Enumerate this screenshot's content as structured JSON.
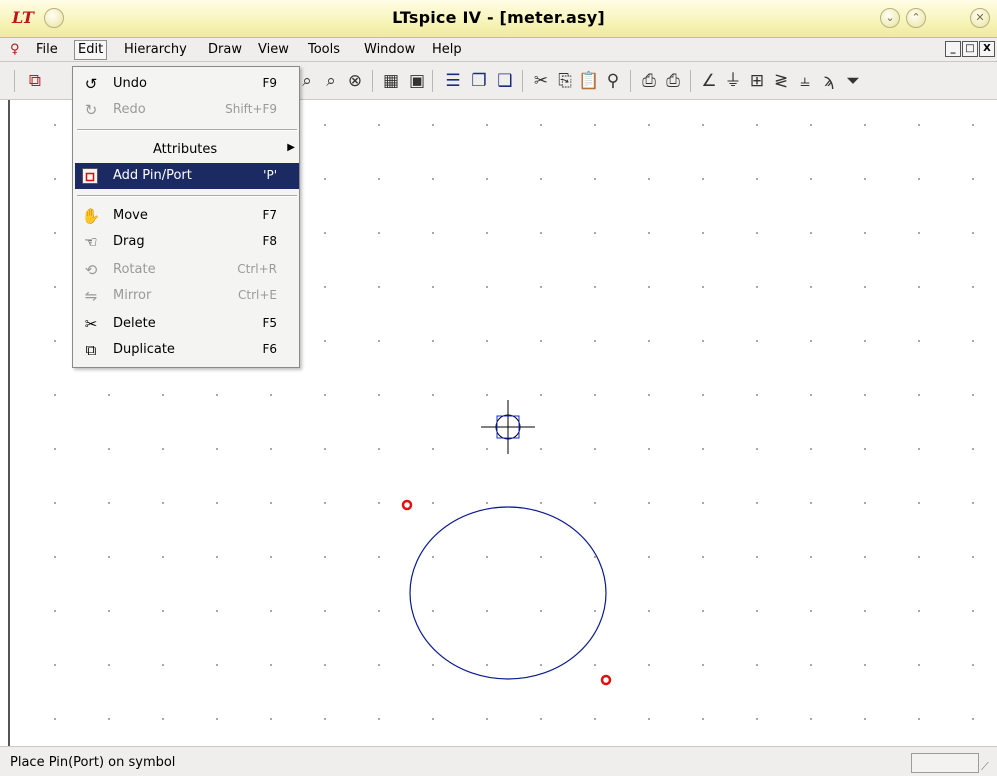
{
  "window": {
    "title": "LTspice IV - [meter.asy]",
    "logo": "LT"
  },
  "menubar": {
    "items": [
      "File",
      "Edit",
      "Hierarchy",
      "Draw",
      "View",
      "Tools",
      "Window",
      "Help"
    ],
    "active": "Edit",
    "mdi": [
      "_",
      "□",
      "X"
    ]
  },
  "edit_menu": {
    "items": [
      {
        "label": "Undo",
        "shortcut": "F9",
        "icon": "undo-icon",
        "enabled": true
      },
      {
        "label": "Redo",
        "shortcut": "Shift+F9",
        "icon": "redo-icon",
        "enabled": false
      },
      {
        "label": "Attributes",
        "shortcut": "",
        "icon": "",
        "enabled": true,
        "submenu": true
      },
      {
        "label": "Add Pin/Port",
        "shortcut": "'P'",
        "icon": "pin-port-icon",
        "enabled": true,
        "highlighted": true
      },
      {
        "label": "Move",
        "shortcut": "F7",
        "icon": "move-hand-icon",
        "enabled": true
      },
      {
        "label": "Drag",
        "shortcut": "F8",
        "icon": "drag-hand-icon",
        "enabled": true
      },
      {
        "label": "Rotate",
        "shortcut": "Ctrl+R",
        "icon": "rotate-icon",
        "enabled": false
      },
      {
        "label": "Mirror",
        "shortcut": "Ctrl+E",
        "icon": "mirror-icon",
        "enabled": false
      },
      {
        "label": "Delete",
        "shortcut": "F5",
        "icon": "scissors-icon",
        "enabled": true
      },
      {
        "label": "Duplicate",
        "shortcut": "F6",
        "icon": "duplicate-icon",
        "enabled": true
      }
    ]
  },
  "statusbar": {
    "text": "Place Pin(Port) on symbol"
  },
  "colors": {
    "menu_highlight": "#1c2a63",
    "symbol_stroke": "#0a1a8c",
    "pin_marker": "#e01010"
  }
}
